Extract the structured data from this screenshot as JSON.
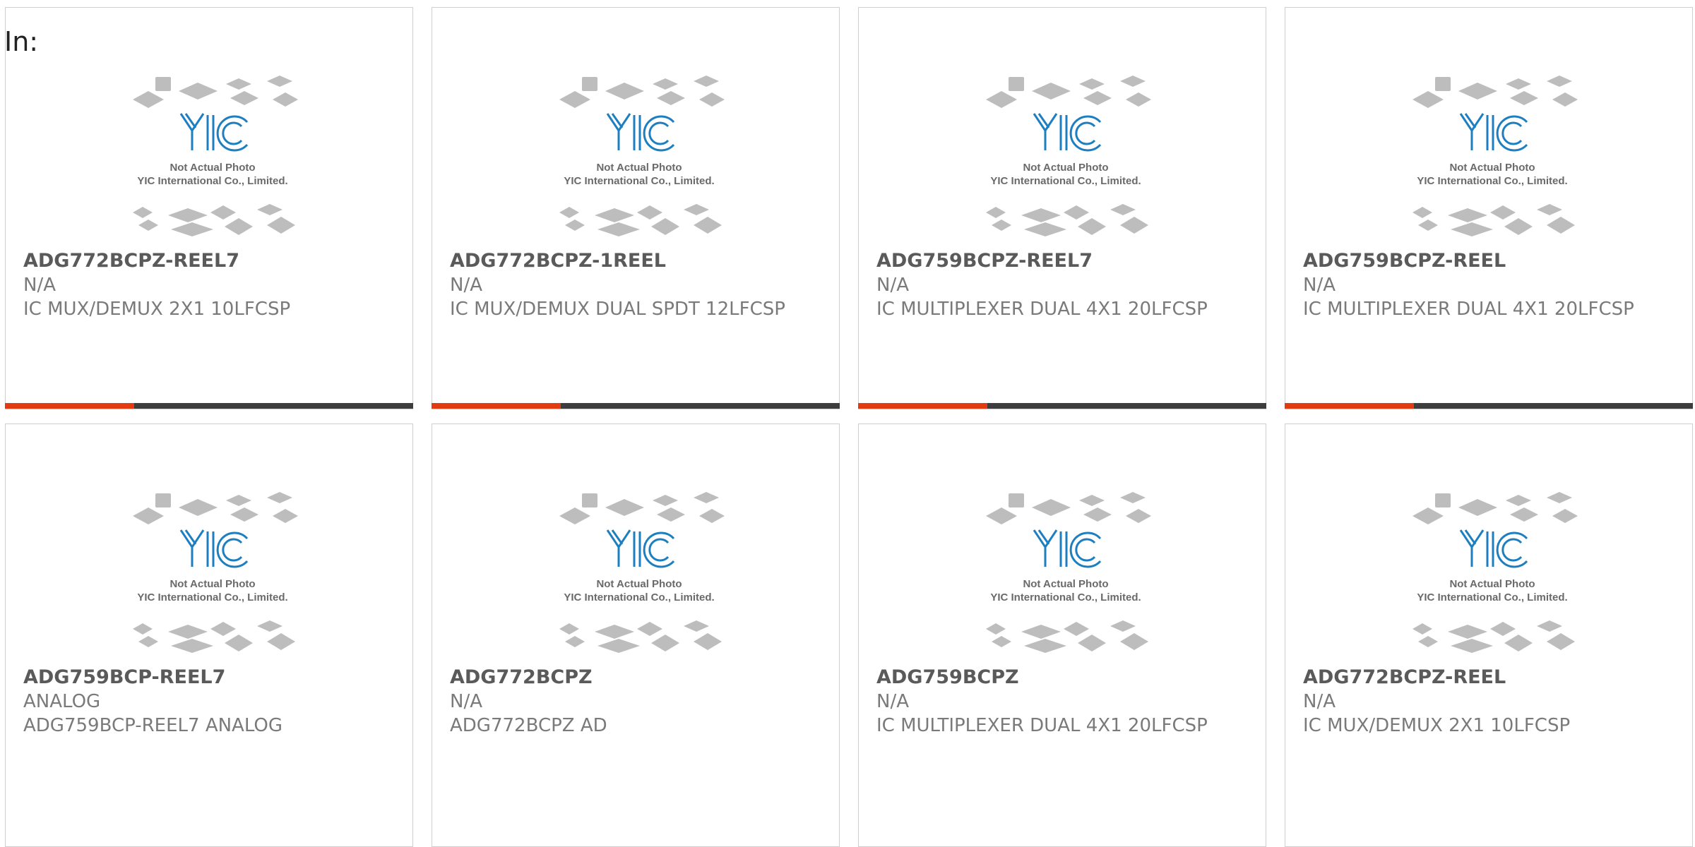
{
  "page": {
    "label": "In:"
  },
  "thumbnail": {
    "caption_line1": "Not Actual Photo",
    "caption_line2": "YIC International Co., Limited.",
    "logo_text": "YIC",
    "logo_color": "#1e7fc0"
  },
  "colors": {
    "accent": "#e23b12",
    "bar": "#3d3d3d",
    "border": "#cfcfcf"
  },
  "products": [
    {
      "part": "ADG772BCPZ-REEL7",
      "manufacturer": "N/A",
      "description": "IC MUX/DEMUX 2X1 10LFCSP"
    },
    {
      "part": "ADG772BCPZ-1REEL",
      "manufacturer": "N/A",
      "description": "IC MUX/DEMUX DUAL SPDT 12LFCSP"
    },
    {
      "part": "ADG759BCPZ-REEL7",
      "manufacturer": "N/A",
      "description": "IC MULTIPLEXER DUAL 4X1 20LFCSP"
    },
    {
      "part": "ADG759BCPZ-REEL",
      "manufacturer": "N/A",
      "description": "IC MULTIPLEXER DUAL 4X1 20LFCSP"
    },
    {
      "part": "ADG759BCP-REEL7",
      "manufacturer": "ANALOG",
      "description": "ADG759BCP-REEL7 ANALOG"
    },
    {
      "part": "ADG772BCPZ",
      "manufacturer": "N/A",
      "description": "ADG772BCPZ AD"
    },
    {
      "part": "ADG759BCPZ",
      "manufacturer": "N/A",
      "description": "IC MULTIPLEXER DUAL 4X1 20LFCSP"
    },
    {
      "part": "ADG772BCPZ-REEL",
      "manufacturer": "N/A",
      "description": "IC MUX/DEMUX 2X1 10LFCSP"
    }
  ]
}
